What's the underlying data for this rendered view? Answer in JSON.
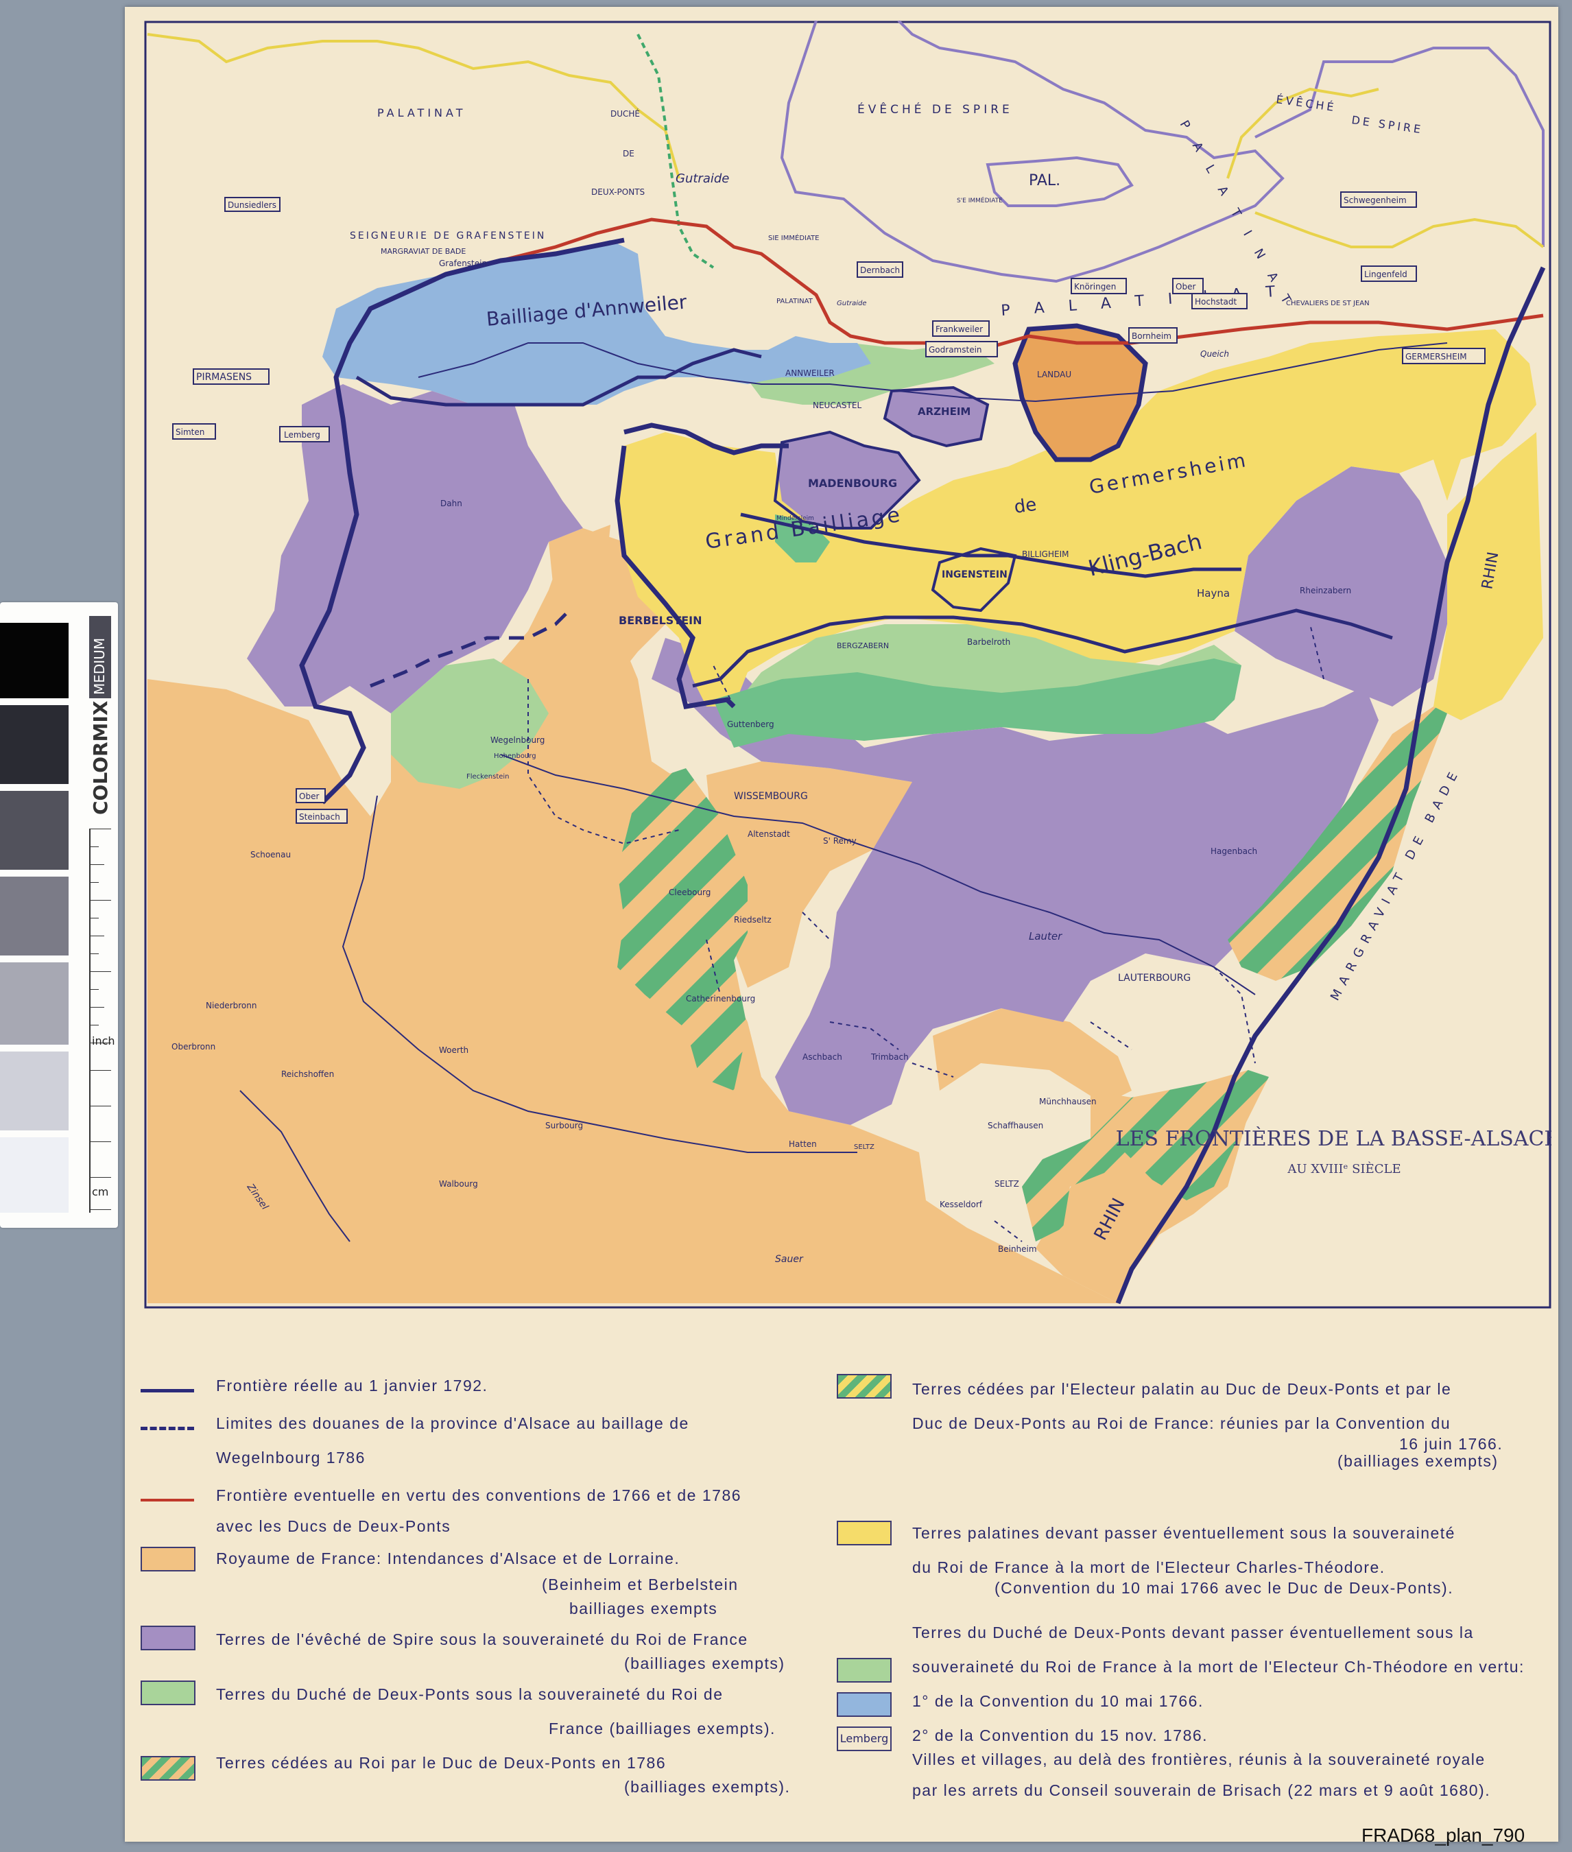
{
  "map": {
    "title": "LES FRONTIÈRES DE LA BASSE-ALSACE",
    "subtitle": "AU XVIIIᵉ SIÈCLE",
    "regions": {
      "palatinat_nw": "PALATINAT",
      "duche": "DUCHÉ",
      "de": "DE",
      "deux_ponts": "DEUX-PONTS",
      "gutraide_1": "Gutraide",
      "eveche_spire": "ÉVÊCHÉ   DE   SPIRE",
      "pal": "PAL.",
      "eveche_spire_ne_1": "ÉVÊCHÉ",
      "eveche_spire_ne_2": "DE   SPIRE",
      "palatinat_ne": "P A L A T I N A T",
      "seigneurie": "SEIGNEURIE  DE  GRAFENSTEIN",
      "margraviat_bade_n": "MARGRAVIAT DE BADE",
      "annweiler": "Bailliage d'Annweiler",
      "palatinat_mid": "PALATINAT",
      "palatinat_band": "P A L A T I N A T",
      "germersheim_1": "Grand   Bailliage",
      "germersheim_2": "de",
      "germersheim_3": "Germersheim",
      "kling_bach": "Kling-Bach",
      "rhin_right": "RHIN",
      "rhin_bottom": "RHIN",
      "margraviat_bade": "MARGRAVIAT  DE  BADE",
      "lauter": "Lauter",
      "sauer": "Sauer",
      "zinsel": "Zinsel",
      "chevaliers": "CHEVALIERS DE ST JEAN",
      "queich": "Queich",
      "imediate": "SIE IMMÉDIATE",
      "imediate2": "S'E IMMÉDIATE",
      "gutraide_2": "Gutraide"
    },
    "places": {
      "grafenstein": "Grafenstein",
      "annweiler": "ANNWEILER",
      "neucastel": "NEUCASTEL",
      "arzheim": "ARZHEIM",
      "landau": "LANDAU",
      "madenbourg": "MADENBOURG",
      "mindersheim": "Mindersleim",
      "billigheim": "BILLIGHEIM",
      "ingenstein": "INGENSTEIN",
      "dahn": "Dahn",
      "berbelstein": "BERBELSTEIN",
      "bergzabern": "BERGZABERN",
      "barbelroth": "Barbelroth",
      "hayna": "Hayna",
      "rheinzabern": "Rheinzabern",
      "guttenberg": "Guttenberg",
      "wegelnbourg": "Wegelnbourg",
      "hohenbourg": "Hohenbourg",
      "fleckenstein": "Fleckenstein",
      "wissembourg": "WISSEMBOURG",
      "altenstadt": "Altenstadt",
      "st_remy": "S' Remy",
      "schoenau": "Schoenau",
      "cleebourg": "Cleebourg",
      "riedselz": "Riedseltz",
      "catherinenbourg": "Catherinenbourg",
      "hagenbach": "Hagenbach",
      "lauterbourg": "LAUTERBOURG",
      "niederbronn": "Niederbronn",
      "oberbronn": "Oberbronn",
      "reichshoffen": "Reichshoffen",
      "woerth": "Woerth",
      "aschbach": "Aschbach",
      "trimbach": "Trimbach",
      "munchhausen": "Münchhausen",
      "schaffhausen": "Schaffhausen",
      "surbourg": "Surbourg",
      "hatten": "Hatten",
      "seltz_road": "SELTZ",
      "seltz": "SELTZ",
      "kesseldorf": "Kesseldorf",
      "walbourg": "Walbourg",
      "beinheim": "Beinheim"
    },
    "boxed_places": {
      "dunsbach": "Dunsiedlers",
      "pirmasens": "PIRMASENS",
      "simten": "Simten",
      "lemberg": "Lemberg",
      "dernbach": "Dernbach",
      "frankweiler": "Frankweiler",
      "godramstein": "Godramstein",
      "knoringen": "Knöringen",
      "ober": "Ober",
      "hochstadt": "Hochstadt",
      "bornheim": "Bornheim",
      "schwegenheim": "Schwegenheim",
      "lingenfeld": "Lingenfeld",
      "germersheim": "GERMERSHEIM",
      "ober2": "Ober",
      "steinbach": "Steinbach"
    }
  },
  "legend": {
    "item1": "Frontière réelle au 1 janvier 1792.",
    "item2a": "Limites des douanes de la province d'Alsace au baillage de",
    "item2b": "Wegelnbourg 1786",
    "item3a": "Frontière eventuelle en vertu des conventions de 1766 et de 1786",
    "item3b": "avec les Ducs de Deux-Ponts",
    "item4a": "Royaume de France: Intendances d'Alsace et de Lorraine.",
    "item4b": "(Beinheim et Berbelstein",
    "item4c": "bailliages exempts",
    "item5a": "Terres de l'évêché de Spire sous la souveraineté du Roi de France",
    "item5b": "(bailliages exempts)",
    "item6a": "Terres du Duché de Deux-Ponts sous la souveraineté du Roi de",
    "item6b": "France (bailliages exempts).",
    "item7a": "Terres cédées au Roi par le Duc de Deux-Ponts en 1786",
    "item7b": "(bailliages exempts).",
    "item8a": "Terres cédées par l'Electeur palatin au Duc de Deux-Ponts et par le",
    "item8b": "Duc de Deux-Ponts au Roi de France: réunies par la Convention du",
    "item8c": "16 juin 1766.",
    "item8d": "(bailliages exempts)",
    "item9a": "Terres palatines devant passer éventuellement sous la souveraineté",
    "item9b": "du Roi de France à la mort de l'Electeur Charles-Théodore.",
    "item9c": "(Convention du 10 mai 1766 avec le Duc de Deux-Ponts).",
    "item10a": "Terres du Duché de Deux-Ponts devant passer éventuellement sous la",
    "item10b": "souveraineté du Roi de France à la mort de l'Electeur Ch-Théodore en vertu:",
    "item11": "1° de la  Convention du 10 mai 1766.",
    "item12": "2° de la  Convention du 15 nov. 1786.",
    "item13_box": "Lemberg",
    "item13a": "Villes et villages, au delà des frontières, réunis à la souveraineté royale",
    "item13b": "par les arrets du Conseil souverain de Brisach (22 mars et 9 août 1680)."
  },
  "colorbar": {
    "brand": "COLORMIX",
    "edition": "MEDIUM",
    "unit_top": "inch",
    "unit_bottom": "cm"
  },
  "archive_code": "FRAD68_plan_790",
  "colors": {
    "france": "#f2c283",
    "spire": "#a48fc2",
    "deux_ponts": "#a9d49a",
    "palatine": "#f5dc6a",
    "blue": "#93b6dd",
    "green_strong": "#6fc08a",
    "border_real": "#2b2a7a",
    "border_red": "#c0392b",
    "border_yellow": "#e8d24a",
    "border_green": "#3fa86b",
    "border_purple": "#8a7ac2",
    "orange_landau": "#e9a45a"
  }
}
